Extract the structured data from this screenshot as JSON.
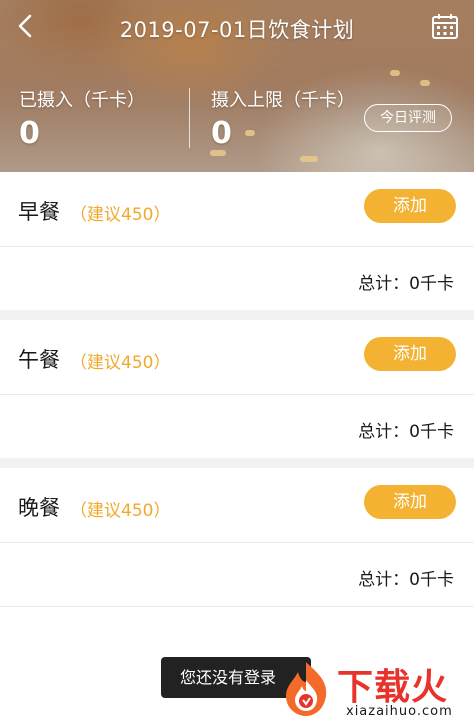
{
  "header": {
    "title": "2019-07-01日饮食计划",
    "intake_label": "已摄入（千卡）",
    "intake_value": "0",
    "limit_label": "摄入上限（千卡）",
    "limit_value": "0",
    "evaluate_label": "今日评测",
    "icons": {
      "back": "back-arrow-icon",
      "calendar": "calendar-icon"
    }
  },
  "meals": [
    {
      "name": "早餐",
      "suggest": "（建议450）",
      "add_label": "添加",
      "total": "总计：0千卡"
    },
    {
      "name": "午餐",
      "suggest": "（建议450）",
      "add_label": "添加",
      "total": "总计：0千卡"
    },
    {
      "name": "晚餐",
      "suggest": "（建议450）",
      "add_label": "添加",
      "total": "总计：0千卡"
    }
  ],
  "toast": {
    "text": "您还没有登录"
  },
  "watermark": {
    "brand": "下载火",
    "url": "xiazaihuo.com"
  },
  "colors": {
    "accent": "#f4b233",
    "suggest": "#f0a92c",
    "watermark": "#e8322c"
  }
}
